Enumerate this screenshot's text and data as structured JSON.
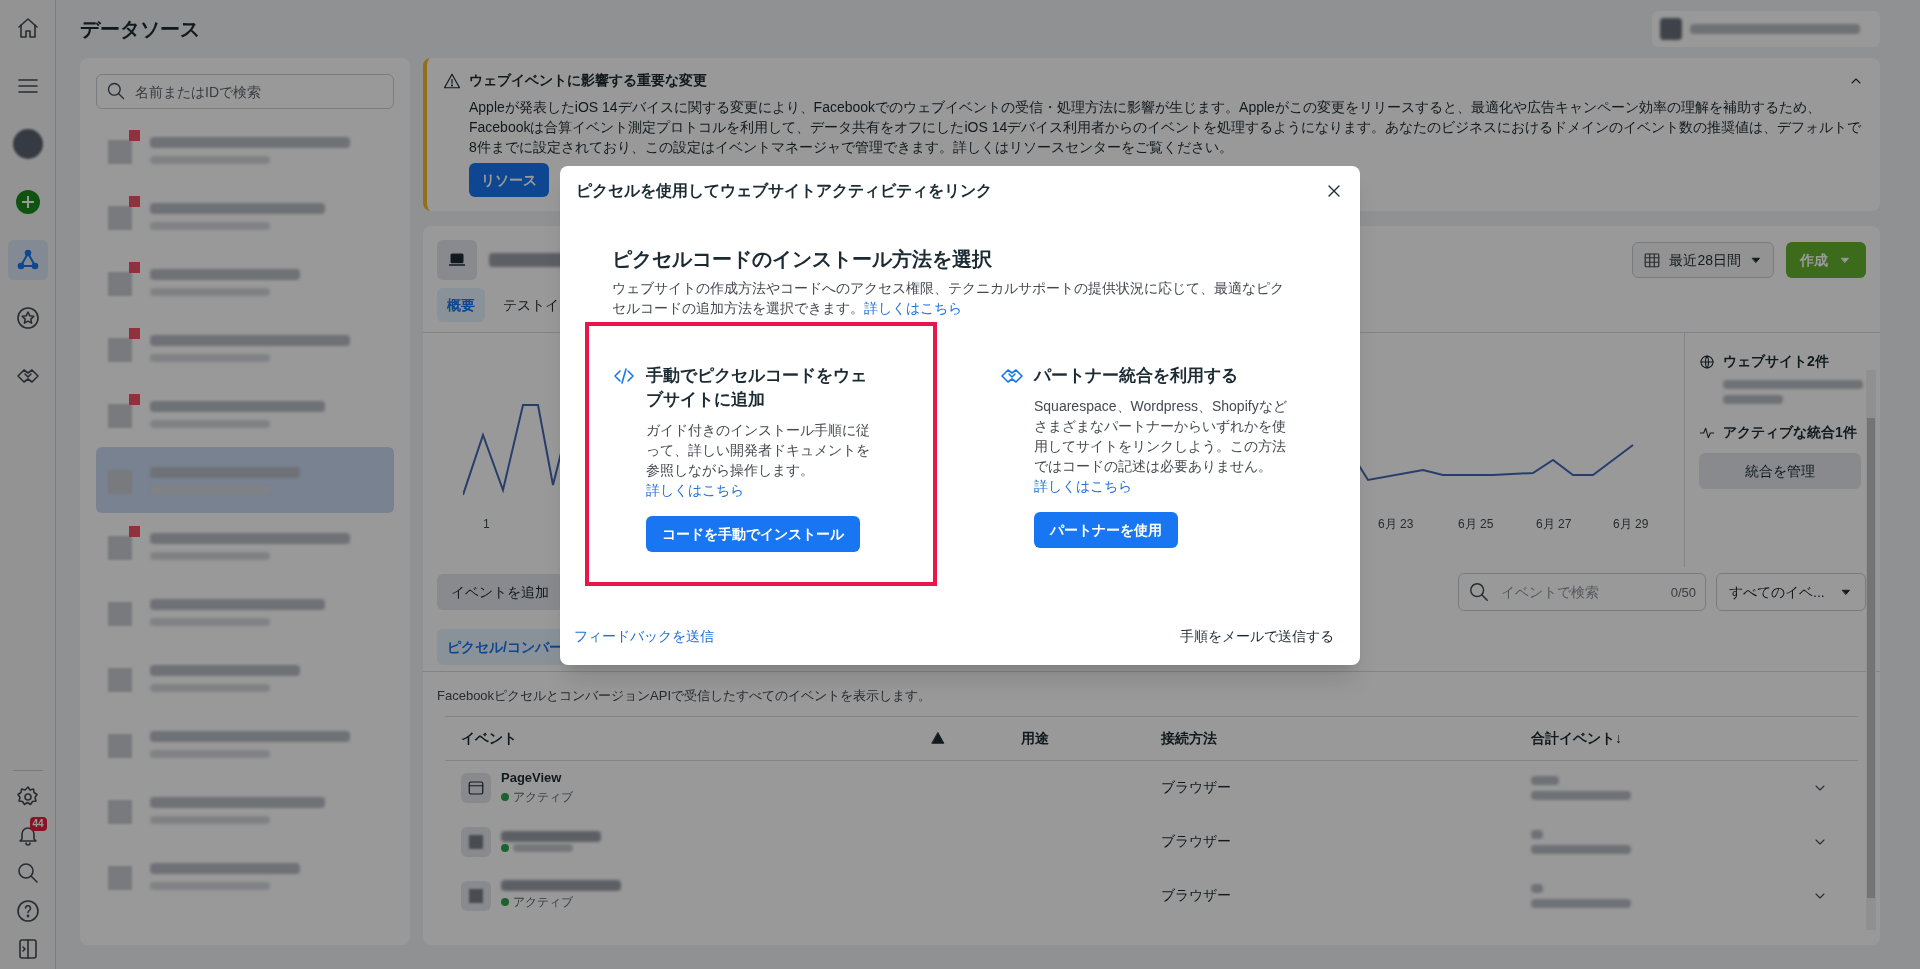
{
  "nav_rail": {
    "top_items": [
      {
        "kind": "home",
        "selected": false
      },
      {
        "kind": "menu",
        "selected": false
      },
      {
        "kind": "avatar",
        "selected": false
      },
      {
        "kind": "add",
        "selected": false
      },
      {
        "kind": "network",
        "selected": true
      },
      {
        "kind": "star",
        "selected": false
      },
      {
        "kind": "handshake",
        "selected": false
      }
    ],
    "bottom_items": [
      {
        "kind": "settings"
      },
      {
        "kind": "bell",
        "badge": "44"
      },
      {
        "kind": "search"
      },
      {
        "kind": "help"
      },
      {
        "kind": "panel"
      }
    ]
  },
  "page_title": "データソース",
  "sidebar": {
    "search": {
      "placeholder": "名前またはIDで検索"
    },
    "items": [
      {
        "warning": true,
        "selected": false
      },
      {
        "warning": true,
        "selected": false
      },
      {
        "warning": true,
        "selected": false
      },
      {
        "warning": true,
        "selected": false
      },
      {
        "warning": true,
        "selected": false
      },
      {
        "warning": false,
        "selected": true
      },
      {
        "warning": true,
        "selected": false
      },
      {
        "warning": false,
        "selected": false
      },
      {
        "warning": false,
        "selected": false
      },
      {
        "warning": false,
        "selected": false
      },
      {
        "warning": false,
        "selected": false
      },
      {
        "warning": false,
        "selected": false
      }
    ]
  },
  "banner": {
    "title": "ウェブイベントに影響する重要な変更",
    "body": "Appleが発表したiOS 14デバイスに関する変更により、Facebookでのウェブイベントの受信・処理方法に影響が生じます。Appleがこの変更をリリースすると、最適化や広告キャンペーン効率の理解を補助するため、Facebookは合算イベント測定プロトコルを利用して、データ共有をオフにしたiOS 14デバイス利用者からのイベントを処理するようになります。あなたのビジネスにおけるドメインのイベント数の推奨値は、デフォルトで8件までに設定されており、この設定はイベントマネージャで管理できます。詳しくはリソースセンターをご覧ください。",
    "button": "リソース",
    "expanded": true
  },
  "source_panel": {
    "tabs": [
      {
        "label": "概要",
        "selected": true
      },
      {
        "label": "テストイ",
        "selected": false
      }
    ],
    "date_range": "最近28日間",
    "create_button": "作成",
    "chart": {
      "x_labels": [
        "1",
        "6月 23",
        "6月 25",
        "6月 27",
        "6月 29"
      ]
    },
    "summary": {
      "websites": "ウェブサイト2件",
      "integrations": "アクティブな統合1件",
      "manage_button": "統合を管理"
    }
  },
  "events": {
    "add_button": "イベントを追加",
    "search": {
      "placeholder": "イベントで検索",
      "counter": "0/50"
    },
    "filter": "すべてのイベ...",
    "tabs": [
      {
        "label": "ピクセル/コンバー",
        "selected": true
      }
    ],
    "description": "FacebookピクセルとコンバージョンAPIで受信したすべてのイベントを表示します。",
    "columns": [
      "イベント",
      "用途",
      "接続方法",
      "合計イベント↓"
    ],
    "rows": [
      {
        "name": "PageView",
        "status": "アクティブ",
        "active": true,
        "connection": "ブラウザー"
      },
      {
        "active": true,
        "connection": "ブラウザー"
      },
      {
        "status": "アクティブ",
        "active": true,
        "connection": "ブラウザー"
      }
    ]
  },
  "modal": {
    "title": "ピクセルを使用してウェブサイトアクティビティをリンク",
    "heading": "ピクセルコードのインストール方法を選択",
    "description": "ウェブサイトの作成方法やコードへのアクセス権限、テクニカルサポートの提供状況に応じて、最適なピクセルコードの追加方法を選択できます。",
    "description_link": "詳しくはこちら",
    "options": [
      {
        "kind": "code",
        "title": "手動でピクセルコードをウェブサイトに追加",
        "text": "ガイド付きのインストール手順に従って、詳しい開発者ドキュメントを参照しながら操作します。",
        "link": "詳しくはこちら",
        "button": "コードを手動でインストール",
        "highlighted": true
      },
      {
        "kind": "partner",
        "title": "パートナー統合を利用する",
        "text": "Squarespace、Wordpress、Shopifyなどさまざまなパートナーからいずれかを使用してサイトをリンクしよう。この方法ではコードの記述は必要ありません。",
        "link": "詳しくはこちら",
        "button": "パートナーを使用",
        "highlighted": false
      }
    ],
    "feedback_link": "フィードバックを送信",
    "email_link": "手順をメールで送信する"
  }
}
